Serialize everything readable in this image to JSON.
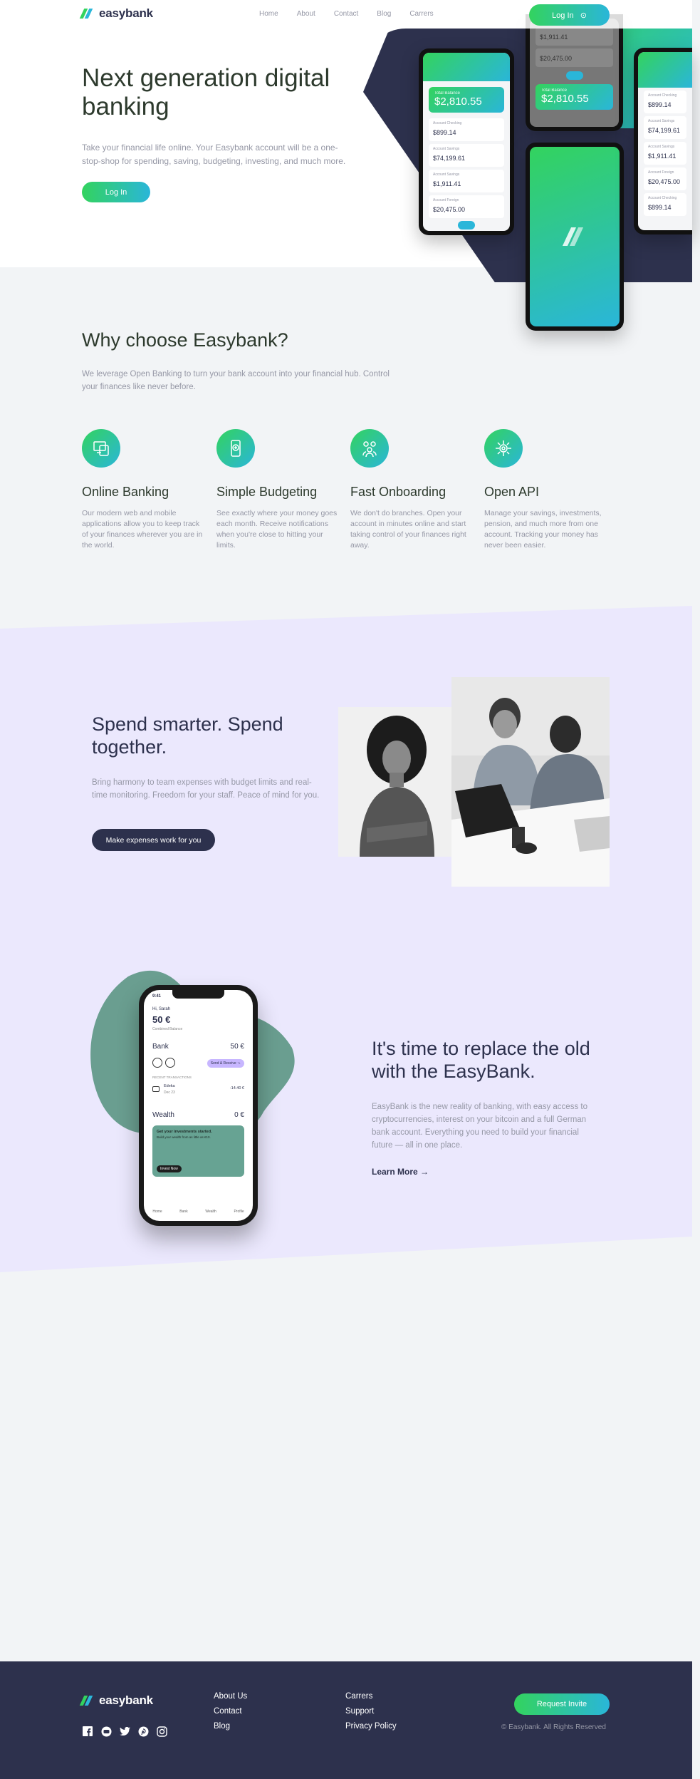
{
  "brand": {
    "name": "easybank",
    "accent_green": "#33d35e",
    "accent_cyan": "#2ab6d9",
    "dark": "#2d314d",
    "lavender": "#ebe8fd"
  },
  "nav": {
    "items": [
      "Home",
      "About",
      "Contact",
      "Blog",
      "Carrers"
    ],
    "login_label": "Log In"
  },
  "hero": {
    "title": "Next generation digital banking",
    "text": "Take your financial life online. Your Easybank account will be a one-stop-shop for spending, saving, budgeting, investing, and much more.",
    "cta": "Log In",
    "phone_left": {
      "main_label": "Total Balance",
      "main_value": "$2,810.55",
      "rows": [
        {
          "label": "Account Checking",
          "value": "$899.14"
        },
        {
          "label": "Account Savings",
          "value": "$74,199.61"
        },
        {
          "label": "Account Savings",
          "value": "$1,911.41"
        },
        {
          "label": "Account Foreign",
          "value": "$20,475.00"
        }
      ]
    },
    "phone_mid": {
      "rows": [
        {
          "label": "",
          "value": "$1,911.41"
        },
        {
          "label": "",
          "value": "$20,475.00"
        }
      ],
      "main_label": "Total Balance",
      "main_value": "$2,810.55"
    },
    "phone_right": {
      "rows": [
        {
          "label": "Account Checking",
          "value": "$899.14"
        },
        {
          "label": "Account Savings",
          "value": "$74,199.61"
        },
        {
          "label": "Account Savings",
          "value": "$1,911.41"
        },
        {
          "label": "Account Foreign",
          "value": "$20,475.00"
        },
        {
          "label": "Account Checking",
          "value": "$899.14"
        }
      ]
    }
  },
  "why": {
    "title": "Why choose Easybank?",
    "text": "We leverage Open Banking to turn your bank account into your financial hub. Control your finances like never before.",
    "features": [
      {
        "icon": "online-banking-icon",
        "title": "Online Banking",
        "text": "Our modern web and mobile applications allow you to keep track of your finances wherever you are in the world."
      },
      {
        "icon": "budgeting-icon",
        "title": "Simple Budgeting",
        "text": "See exactly where your money goes each month. Receive notifications when you're close to hitting your limits."
      },
      {
        "icon": "onboarding-icon",
        "title": "Fast Onboarding",
        "text": "We don't do branches. Open your account in minutes online and start taking control of your finances right away."
      },
      {
        "icon": "api-icon",
        "title": "Open API",
        "text": "Manage your savings, investments, pension, and much more from one account. Tracking your money has never been easier."
      }
    ]
  },
  "spend": {
    "title": "Spend smarter. Spend together.",
    "text": "Bring harmony to team expenses with budget limits and real-time monitoring. Freedom for your staff. Peace of mind for you.",
    "cta": "Make expenses work for you"
  },
  "app": {
    "time": "9:41",
    "greeting": "Hi, Sarah",
    "balance": "50 €",
    "balance_label": "Combined Balance",
    "bank_label": "Bank",
    "bank_value": "50 €",
    "send_label": "Send & Receive ↑↓",
    "recent_label": "RECENT TRANSACTIONS",
    "tx_name": "Edeka",
    "tx_date": "Dec 23",
    "tx_amount": "-14.40 €",
    "wealth_label": "Wealth",
    "wealth_value": "0 €",
    "wealth_card_title": "Get your investments started.",
    "wealth_card_text": "Build your wealth from as little as €10.",
    "invest_label": "Invest Now",
    "tabs": [
      "Home",
      "Bank",
      "Wealth",
      "Profile"
    ]
  },
  "replace": {
    "title": "It's time to replace the old with the EasyBank.",
    "text": "EasyBank is the new reality of banking, with easy access to cryptocurrencies, interest on your bitcoin and a full German bank account. Everything you need to build your financial future — all in one place.",
    "link": "Learn More →"
  },
  "footer": {
    "col1": [
      "About Us",
      "Contact",
      "Blog"
    ],
    "col2": [
      "Carrers",
      "Support",
      "Privacy Policy"
    ],
    "cta": "Request Invite",
    "copyright": "© Easybank. All Rights Reserved",
    "socials": [
      "facebook-icon",
      "youtube-icon",
      "twitter-icon",
      "pinterest-icon",
      "instagram-icon"
    ]
  }
}
